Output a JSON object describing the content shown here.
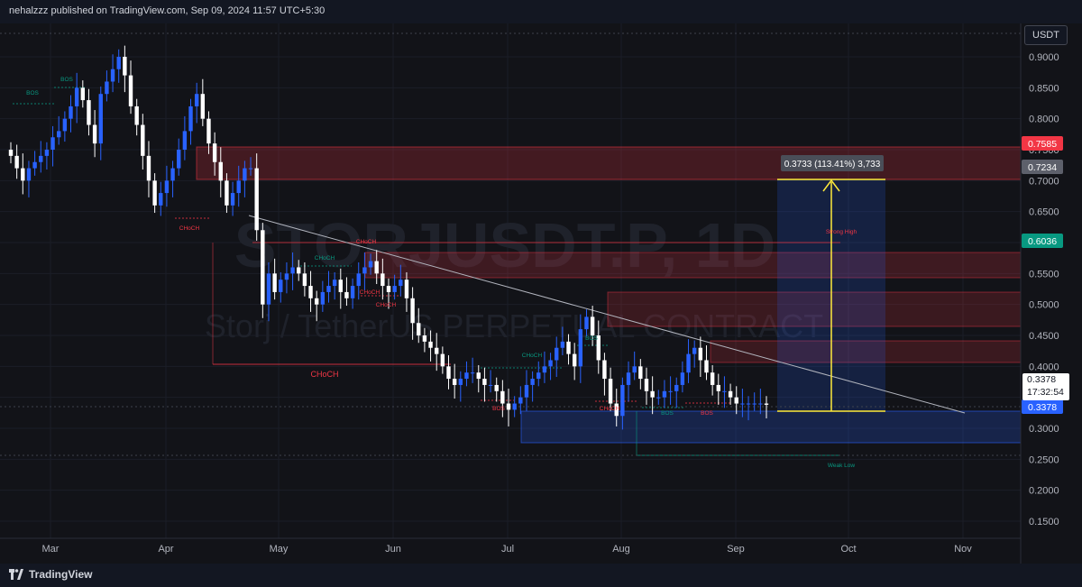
{
  "header": {
    "publish_text": "nehalzzz published on TradingView.com, Sep 09, 2024 11:57 UTC+5:30"
  },
  "watermark": {
    "symbol": "STORJUSDT.P, 1D",
    "description": "Storj / TetherUS PERPETUAL CONTRACT"
  },
  "currency_label": "USDT",
  "price_axis": {
    "ticks": [
      "0.9000",
      "0.8500",
      "0.8000",
      "0.7500",
      "0.7000",
      "0.6500",
      "0.6000",
      "0.5500",
      "0.5000",
      "0.4500",
      "0.4000",
      "0.3500",
      "0.3000",
      "0.2500",
      "0.2000",
      "0.1500"
    ]
  },
  "time_axis": {
    "ticks": [
      "Mar",
      "Apr",
      "May",
      "Jun",
      "Jul",
      "Aug",
      "Sep",
      "Oct",
      "Nov"
    ]
  },
  "price_tags": [
    {
      "value": "0.7585",
      "color": "#f23645"
    },
    {
      "value": "0.7234",
      "color": "#5d606b"
    },
    {
      "value": "0.6036",
      "color": "#089981"
    },
    {
      "value": "0.3378",
      "color": "#2962ff"
    }
  ],
  "current_price": {
    "price": "0.3378",
    "countdown": "17:32:54"
  },
  "measure_label": "0.3733 (113.41%) 3,733",
  "annotations": [
    {
      "text": "BOS",
      "color": "#089981"
    },
    {
      "text": "BOS",
      "color": "#089981"
    },
    {
      "text": "CHoCH",
      "color": "#f23645"
    },
    {
      "text": "CHoCH",
      "color": "#089981"
    },
    {
      "text": "CHoCH",
      "color": "#f23645"
    },
    {
      "text": "CHoCH",
      "color": "#f23645"
    },
    {
      "text": "CHoCH",
      "color": "#f23645"
    },
    {
      "text": "BOS",
      "color": "#089981"
    },
    {
      "text": "CHoCH",
      "color": "#089981"
    },
    {
      "text": "BOS",
      "color": "#f23645"
    },
    {
      "text": "CHoCH",
      "color": "#f23645"
    },
    {
      "text": "BOS",
      "color": "#089981"
    },
    {
      "text": "BOS",
      "color": "#f23645"
    },
    {
      "text": "Strong High",
      "color": "#f23645"
    },
    {
      "text": "Weak Low",
      "color": "#089981"
    },
    {
      "text": "CHoCH",
      "color": "#f23645"
    }
  ],
  "footer": {
    "brand": "TradingView"
  },
  "chart_data": {
    "type": "candlestick",
    "symbol": "STORJUSDT.P",
    "timeframe": "1D",
    "y_range": [
      0.1,
      0.96
    ],
    "x_months": [
      "Mar",
      "Apr",
      "May",
      "Jun",
      "Jul",
      "Aug",
      "Sep",
      "Oct",
      "Nov"
    ],
    "closes_approx": [
      0.74,
      0.72,
      0.7,
      0.72,
      0.73,
      0.74,
      0.75,
      0.77,
      0.78,
      0.8,
      0.82,
      0.85,
      0.83,
      0.79,
      0.76,
      0.84,
      0.86,
      0.88,
      0.9,
      0.87,
      0.82,
      0.79,
      0.74,
      0.7,
      0.66,
      0.68,
      0.7,
      0.72,
      0.75,
      0.78,
      0.82,
      0.84,
      0.8,
      0.76,
      0.73,
      0.7,
      0.66,
      0.68,
      0.7,
      0.72,
      0.72,
      0.62,
      0.5,
      0.55,
      0.52,
      0.54,
      0.55,
      0.56,
      0.55,
      0.53,
      0.51,
      0.5,
      0.52,
      0.53,
      0.54,
      0.52,
      0.51,
      0.53,
      0.55,
      0.56,
      0.57,
      0.55,
      0.53,
      0.52,
      0.53,
      0.54,
      0.51,
      0.47,
      0.45,
      0.44,
      0.43,
      0.42,
      0.4,
      0.38,
      0.37,
      0.38,
      0.39,
      0.39,
      0.38,
      0.37,
      0.37,
      0.36,
      0.34,
      0.33,
      0.34,
      0.35,
      0.37,
      0.38,
      0.39,
      0.4,
      0.41,
      0.43,
      0.44,
      0.42,
      0.4,
      0.46,
      0.48,
      0.45,
      0.41,
      0.38,
      0.34,
      0.32,
      0.37,
      0.39,
      0.4,
      0.38,
      0.36,
      0.35,
      0.35,
      0.36,
      0.36,
      0.37,
      0.39,
      0.42,
      0.43,
      0.41,
      0.39,
      0.37,
      0.36,
      0.36,
      0.35,
      0.34,
      0.34,
      0.34,
      0.34,
      0.34,
      0.338
    ]
  }
}
